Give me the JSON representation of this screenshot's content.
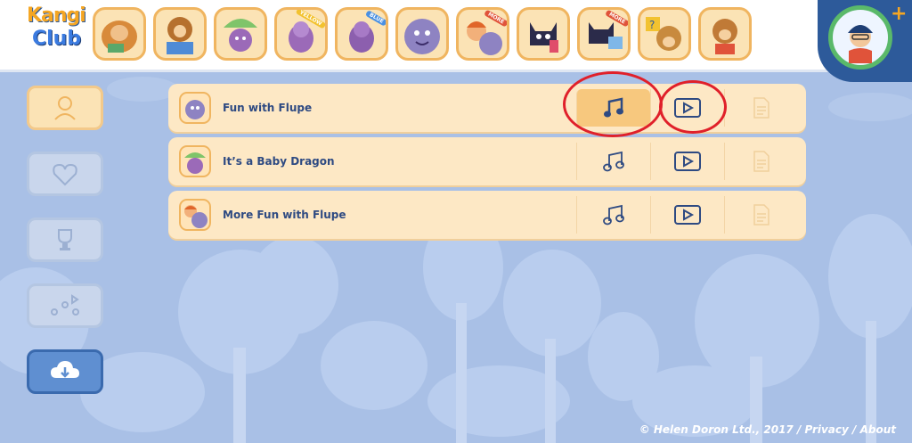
{
  "app": {
    "logo_line1": "Kangi",
    "logo_line2": "Club"
  },
  "top_characters": [
    {
      "name": "dog-reading",
      "tag": ""
    },
    {
      "name": "dog-book",
      "tag": ""
    },
    {
      "name": "baby-dragon-umbrella",
      "tag": ""
    },
    {
      "name": "dragon-yellow",
      "tag": "YELLOW"
    },
    {
      "name": "dragon-blue",
      "tag": "BLUE"
    },
    {
      "name": "flupe",
      "tag": ""
    },
    {
      "name": "boy-flupe",
      "tag": "MORE"
    },
    {
      "name": "black-cat",
      "tag": ""
    },
    {
      "name": "black-cat-photos",
      "tag": "MORE"
    },
    {
      "name": "dog-question",
      "tag": ""
    },
    {
      "name": "dog-scout",
      "tag": ""
    }
  ],
  "songs": [
    {
      "title": "Fun with Flupe",
      "music_selected": true
    },
    {
      "title": "It’s a Baby Dragon",
      "music_selected": false
    },
    {
      "title": "More Fun with Flupe",
      "music_selected": false
    }
  ],
  "footer": {
    "copyright": "© Helen Doron Ltd., 2017",
    "sep": " / ",
    "privacy": "Privacy",
    "about": "About"
  },
  "colors": {
    "background": "#a9c0e6",
    "row": "#fde8c5",
    "accent": "#2e4a82",
    "highlight_circle": "#e0202a"
  }
}
